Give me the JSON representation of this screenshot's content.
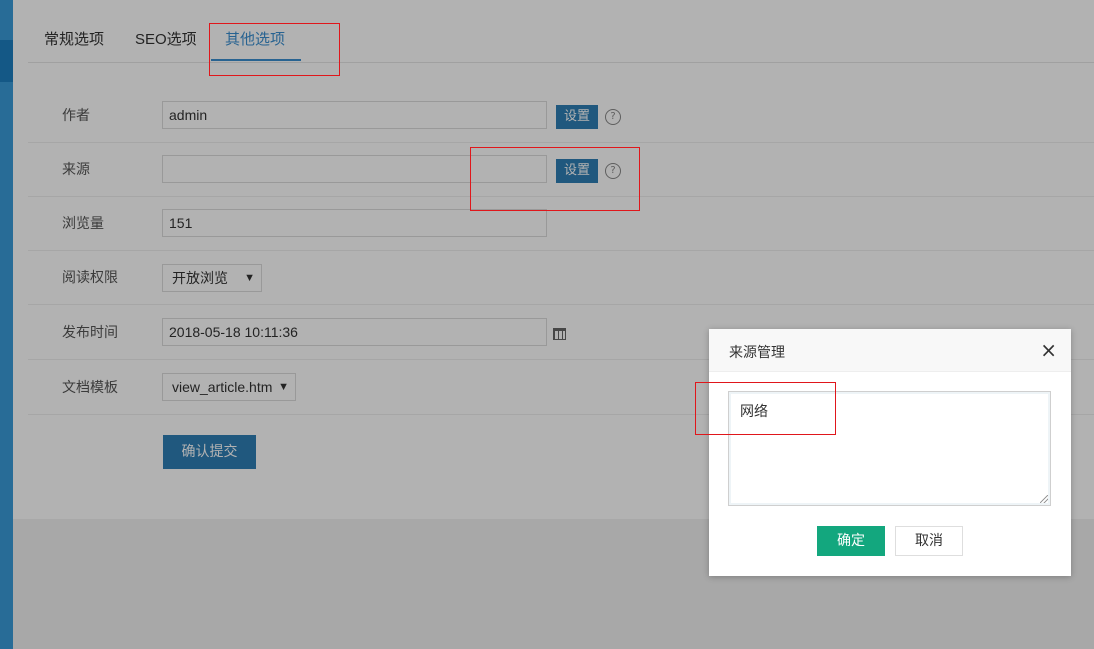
{
  "tabs": [
    {
      "label": "常规选项"
    },
    {
      "label": "SEO选项"
    },
    {
      "label": "其他选项"
    }
  ],
  "form": {
    "author": {
      "label": "作者",
      "value": "admin",
      "button": "设置",
      "help": "?"
    },
    "source": {
      "label": "来源",
      "value": "",
      "button": "设置",
      "help": "?"
    },
    "views": {
      "label": "浏览量",
      "value": "151"
    },
    "read_permission": {
      "label": "阅读权限",
      "selected": "开放浏览"
    },
    "publish_time": {
      "label": "发布时间",
      "value": "2018-05-18 10:11:36"
    },
    "template": {
      "label": "文档模板",
      "selected": "view_article.htm"
    },
    "submit_label": "确认提交"
  },
  "dialog": {
    "title": "来源管理",
    "close": "×",
    "textarea_value": "网络",
    "ok_label": "确定",
    "cancel_label": "取消"
  },
  "colors": {
    "accent": "#3a8fd0",
    "button_blue": "#2f7fb5",
    "ok_green": "#13a77e",
    "annotation_red": "#e0161b"
  },
  "icons": [
    "help-icon",
    "calendar-icon",
    "chevron-down-icon",
    "close-icon"
  ]
}
